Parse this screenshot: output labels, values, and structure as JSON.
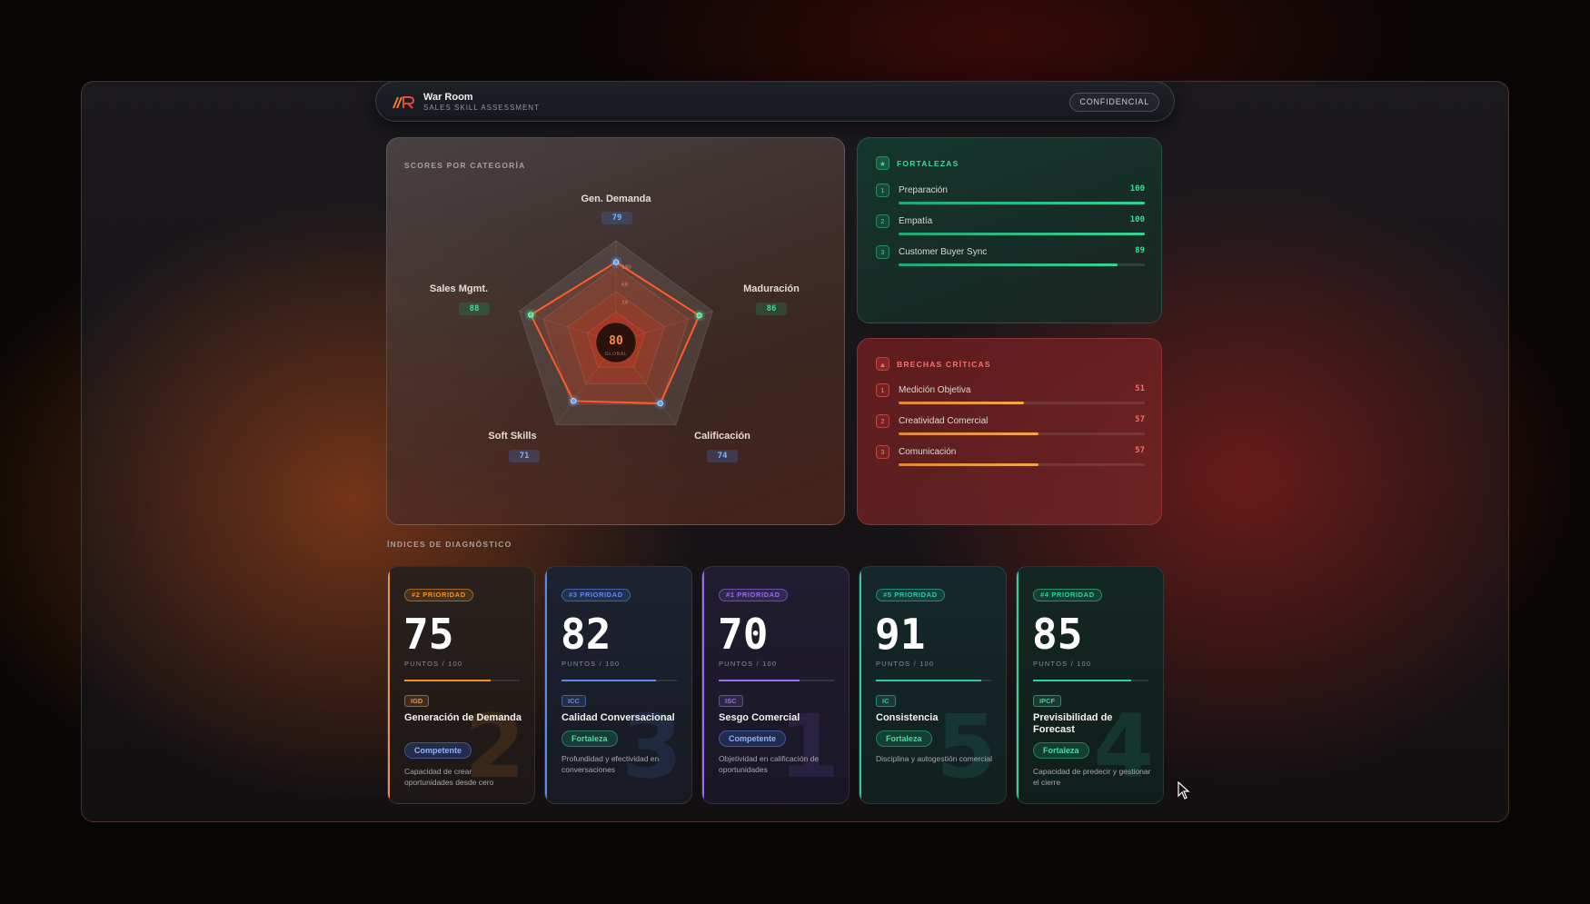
{
  "header": {
    "title": "War Room",
    "subtitle": "SALES SKILL ASSESSMENT",
    "badge": "CONFIDENCIAL"
  },
  "radar": {
    "section_label": "SCORES POR CATEGORÍA",
    "global_score": "80",
    "global_label": "GLOBAL",
    "ring_labels": [
      "100",
      "60",
      "30"
    ],
    "axes": [
      {
        "label": "Gen. Demanda",
        "value": 79
      },
      {
        "label": "Maduración",
        "value": 86
      },
      {
        "label": "Calificación",
        "value": 74
      },
      {
        "label": "Soft Skills",
        "value": 71
      },
      {
        "label": "Sales Mgmt.",
        "value": 88
      }
    ],
    "colors": {
      "polygon": "#ff6a2a",
      "point_blue": "#5aa6ff",
      "point_green": "#30e08a"
    }
  },
  "strengths": {
    "title": "FORTALEZAS",
    "icon": "star-icon",
    "items": [
      {
        "rank": "1",
        "label": "Preparación",
        "score": 100
      },
      {
        "rank": "2",
        "label": "Empatía",
        "score": 100
      },
      {
        "rank": "3",
        "label": "Customer Buyer Sync",
        "score": 89
      }
    ]
  },
  "gaps": {
    "title": "BRECHAS CRÍTICAS",
    "icon": "warning-icon",
    "items": [
      {
        "rank": "1",
        "label": "Medición Objetiva",
        "score": 51
      },
      {
        "rank": "2",
        "label": "Creatividad Comercial",
        "score": 57
      },
      {
        "rank": "3",
        "label": "Comunicación",
        "score": 57
      }
    ]
  },
  "diagnostics": {
    "section_label": "ÍNDICES DE DIAGNÓSTICO",
    "points_label": "PUNTOS / 100",
    "cards": [
      {
        "priority": "#2 PRIORIDAD",
        "score": 75,
        "code": "IGD",
        "title": "Generación de Demanda",
        "status": "Competente",
        "description": "Capacidad de crear oportunidades desde cero",
        "rank_digit": "2",
        "accent": "#f0902e"
      },
      {
        "priority": "#3 PRIORIDAD",
        "score": 82,
        "code": "ICC",
        "title": "Calidad Conversacional",
        "status": "Fortaleza",
        "description": "Profundidad y efectividad en conversaciones",
        "rank_digit": "3",
        "accent": "#5a8cf0"
      },
      {
        "priority": "#1 PRIORIDAD",
        "score": 70,
        "code": "ISC",
        "title": "Sesgo Comercial",
        "status": "Competente",
        "description": "Objetividad en calificación de oportunidades",
        "rank_digit": "1",
        "accent": "#9a6cf0"
      },
      {
        "priority": "#5 PRIORIDAD",
        "score": 91,
        "code": "IC",
        "title": "Consistencia",
        "status": "Fortaleza",
        "description": "Disciplina y autogestión comercial",
        "rank_digit": "5",
        "accent": "#2ec8a8"
      },
      {
        "priority": "#4 PRIORIDAD",
        "score": 85,
        "code": "IPCF",
        "title": "Previsibilidad de Forecast",
        "status": "Fortaleza",
        "description": "Capacidad de predecir y gestionar el cierre",
        "rank_digit": "4",
        "accent": "#2ed39a"
      }
    ]
  }
}
